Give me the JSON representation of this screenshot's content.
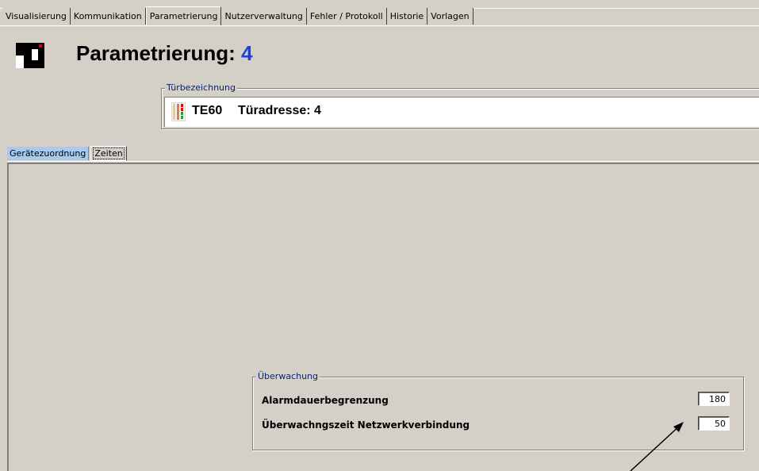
{
  "main_tabs": [
    "Visualisierung",
    "Kommunikation",
    "Parametrierung",
    "Nutzerverwaltung",
    "Fehler / Protokoll",
    "Historie",
    "Vorlagen"
  ],
  "active_main_tab": "Parametrierung",
  "header": {
    "title": "Parametrierung:",
    "number": "4"
  },
  "door_group": {
    "legend": "Türbezeichnung",
    "name": "TE60",
    "address": "Türadresse: 4"
  },
  "sub_tabs": {
    "first": "Gerätezuordnung",
    "second": "Zeiten"
  },
  "monitoring": {
    "legend": "Überwachung",
    "alarm_label": "Alarmdauerbegrenzung",
    "alarm_value": "180",
    "network_label": "Überwachngszeit Netzwerkverbindung",
    "network_value": "50"
  },
  "colors": {
    "background": "#d4d0c8",
    "title_number": "#1f3fd8",
    "inactive_subtab": "#a6caf0",
    "legend_text": "#0a246a"
  }
}
